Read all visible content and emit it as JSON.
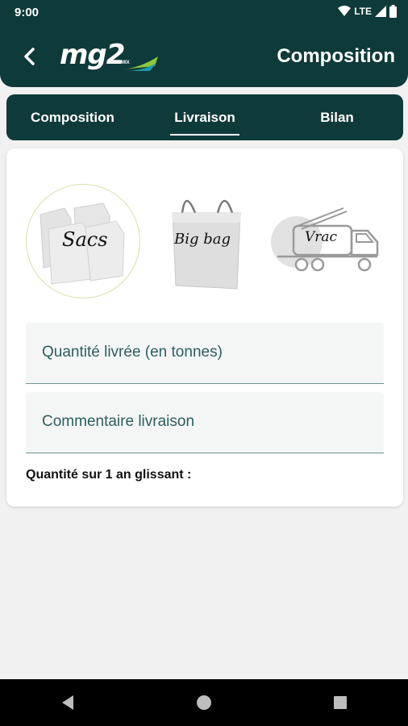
{
  "status": {
    "time": "9:00",
    "network": "LTE"
  },
  "header": {
    "title": "Composition",
    "logo_text": "mg2",
    "logo_sub": "MIX"
  },
  "tabs": [
    {
      "label": "Composition"
    },
    {
      "label": "Livraison",
      "active": true
    },
    {
      "label": "Bilan"
    }
  ],
  "delivery_types": [
    {
      "label": "Sacs",
      "selected": true
    },
    {
      "label": "Big bag",
      "selected": false
    },
    {
      "label": "Vrac",
      "selected": false
    }
  ],
  "fields": {
    "quantity": {
      "placeholder": "Quantité livrée (en tonnes)",
      "value": ""
    },
    "comment": {
      "placeholder": "Commentaire livraison",
      "value": ""
    }
  },
  "rolling_quantity_label": "Quantité sur 1 an glissant :",
  "colors": {
    "primary": "#0f3a3a",
    "accent_green": "#8dc63f",
    "accent_blue": "#1b9aaa"
  }
}
